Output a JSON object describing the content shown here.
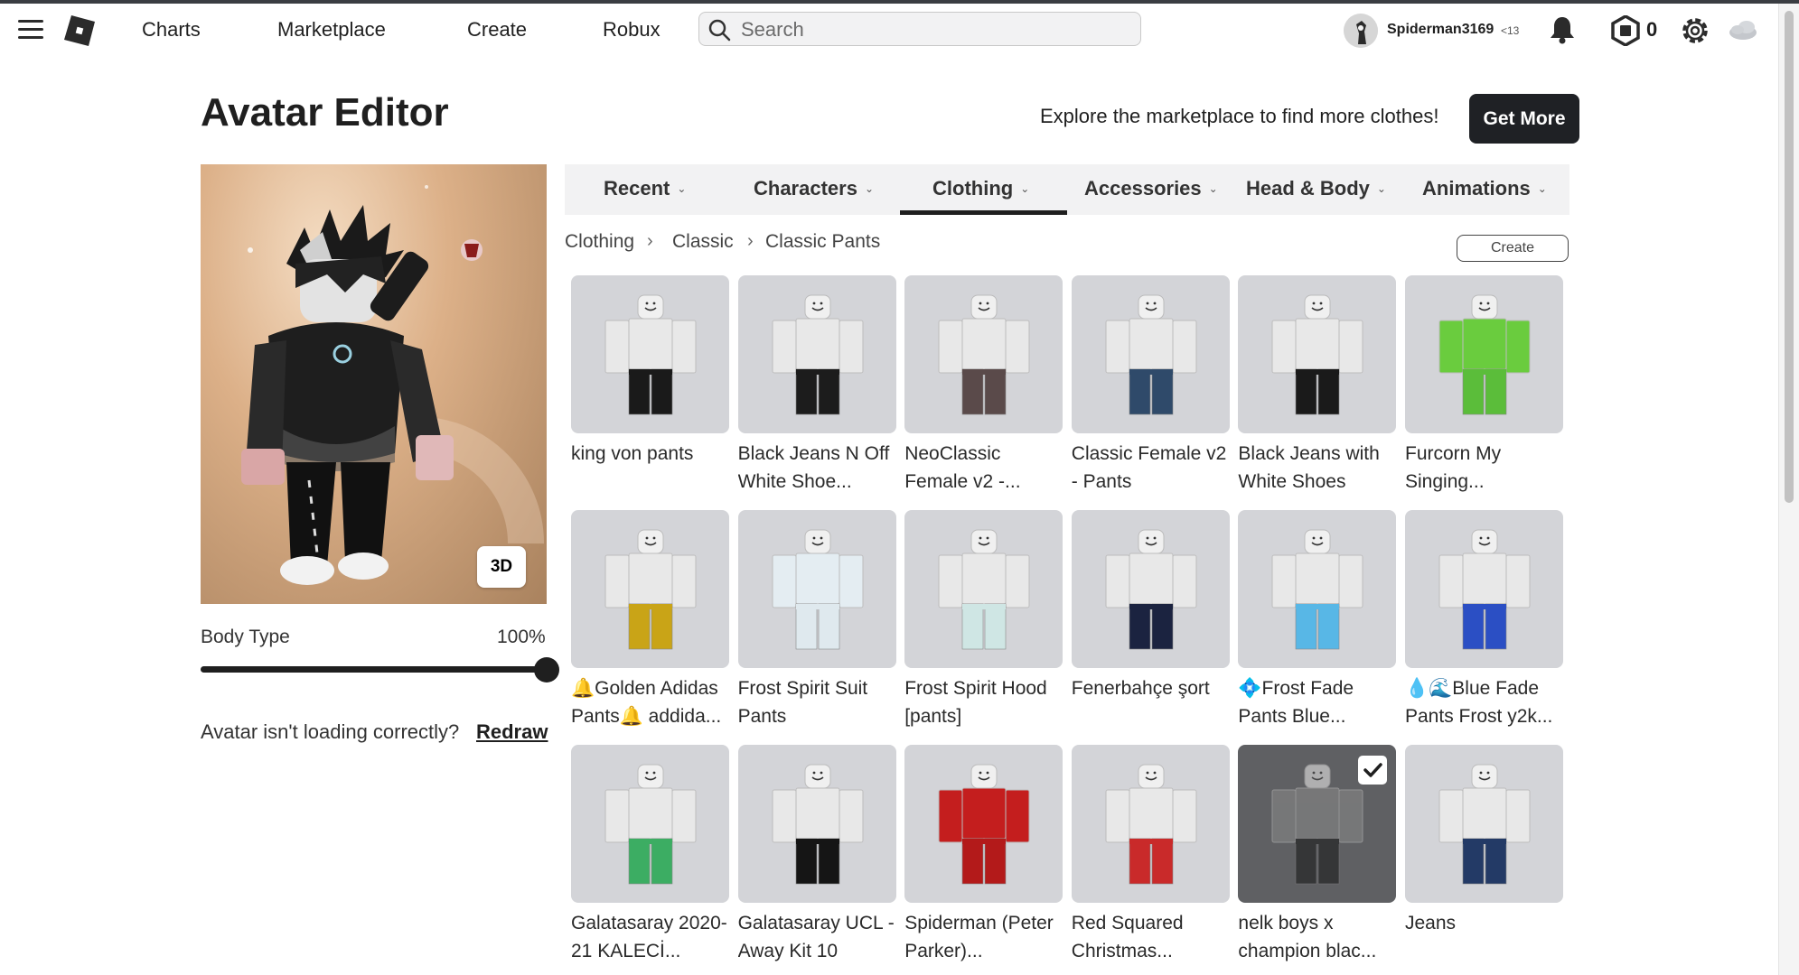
{
  "nav": {
    "links": [
      "Charts",
      "Marketplace",
      "Create",
      "Robux"
    ],
    "search_placeholder": "Search",
    "username": "Spiderman3169",
    "age_badge": "<13",
    "robux_balance": "0"
  },
  "header": {
    "title": "Avatar Editor",
    "explore_text": "Explore the marketplace to find more clothes!",
    "get_more_label": "Get More"
  },
  "preview": {
    "view_toggle_label": "3D",
    "body_type_label": "Body Type",
    "body_type_value": "100%",
    "body_type_level": 1.0,
    "loading_message": "Avatar isn't loading correctly?",
    "redraw_label": "Redraw"
  },
  "tabs": [
    {
      "label": "Recent",
      "active": false
    },
    {
      "label": "Characters",
      "active": false
    },
    {
      "label": "Clothing",
      "active": true
    },
    {
      "label": "Accessories",
      "active": false
    },
    {
      "label": "Head & Body",
      "active": false
    },
    {
      "label": "Animations",
      "active": false
    }
  ],
  "breadcrumb": [
    "Clothing",
    "Classic",
    "Classic Pants"
  ],
  "create_label": "Create",
  "items": [
    {
      "name": "king von pants",
      "pants_color": "#1a1a1a",
      "torso_color": "#e8e8e8",
      "equipped": false
    },
    {
      "name": "Black Jeans N Off White Shoe...",
      "pants_color": "#1c1c1c",
      "torso_color": "#e8e8e8",
      "equipped": false
    },
    {
      "name": "NeoClassic Female v2 -...",
      "pants_color": "#5a4a4a",
      "torso_color": "#e8e8e8",
      "equipped": false
    },
    {
      "name": "Classic Female v2 - Pants",
      "pants_color": "#2f4a6a",
      "torso_color": "#e8e8e8",
      "equipped": false
    },
    {
      "name": "Black Jeans with White Shoes",
      "pants_color": "#1a1a1a",
      "torso_color": "#e8e8e8",
      "equipped": false
    },
    {
      "name": "Furcorn My Singing...",
      "pants_color": "#5bbd3a",
      "torso_color": "#6acc3e",
      "equipped": false
    },
    {
      "name": "🔔Golden Adidas Pants🔔 addida...",
      "pants_color": "#c9a417",
      "torso_color": "#e8e8e8",
      "equipped": false
    },
    {
      "name": "Frost Spirit Suit Pants",
      "pants_color": "#dfe9ee",
      "torso_color": "#e4edf2",
      "equipped": false
    },
    {
      "name": "Frost Spirit Hood [pants]",
      "pants_color": "#cfe6e4",
      "torso_color": "#e8e8e8",
      "equipped": false
    },
    {
      "name": "Fenerbahçe şort",
      "pants_color": "#1b2340",
      "torso_color": "#e8e8e8",
      "equipped": false
    },
    {
      "name": "💠Frost Fade Pants Blue...",
      "pants_color": "#58b7e6",
      "torso_color": "#e8e8e8",
      "equipped": false
    },
    {
      "name": "💧🌊Blue Fade Pants Frost y2k...",
      "pants_color": "#2b4fc4",
      "torso_color": "#e8e8e8",
      "equipped": false
    },
    {
      "name": "Galatasaray 2020-21 KALECİ...",
      "pants_color": "#3cad63",
      "torso_color": "#e8e8e8",
      "equipped": false
    },
    {
      "name": "Galatasaray UCL - Away Kit 10",
      "pants_color": "#151515",
      "torso_color": "#e8e8e8",
      "equipped": false
    },
    {
      "name": "Spiderman (Peter Parker)...",
      "pants_color": "#b31a1a",
      "torso_color": "#c41e1e",
      "equipped": false
    },
    {
      "name": "Red Squared Christmas...",
      "pants_color": "#c92a2a",
      "torso_color": "#e8e8e8",
      "equipped": false
    },
    {
      "name": "nelk boys x champion blac...",
      "pants_color": "#141414",
      "torso_color": "#8a8a8a",
      "equipped": true
    },
    {
      "name": "Jeans",
      "pants_color": "#233a66",
      "torso_color": "#e8e8e8",
      "equipped": false
    }
  ]
}
